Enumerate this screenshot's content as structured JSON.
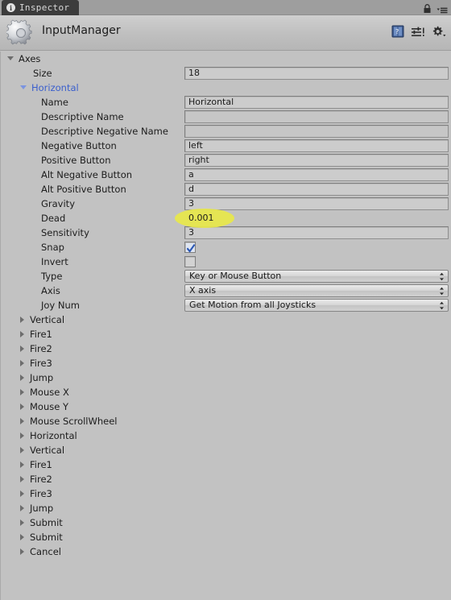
{
  "window": {
    "tab_label": "Inspector",
    "tab_icon": "info-circle-icon",
    "lock_icon": "lock-icon",
    "tab_menu_icon": "hamburger-menu-icon"
  },
  "header": {
    "icon": "gear-logo-icon",
    "title": "InputManager",
    "icons": [
      {
        "name": "help-book-icon"
      },
      {
        "name": "preset-sliders-icon"
      },
      {
        "name": "settings-gear-icon"
      }
    ]
  },
  "inspector": {
    "root": {
      "label": "Axes",
      "expanded": true
    },
    "size": {
      "label": "Size",
      "value": "18"
    },
    "expanded_axis": {
      "label": "Horizontal",
      "expanded": true,
      "properties": [
        {
          "label": "Name",
          "type": "text",
          "value": "Horizontal"
        },
        {
          "label": "Descriptive Name",
          "type": "text",
          "value": ""
        },
        {
          "label": "Descriptive Negative Name",
          "type": "text",
          "value": ""
        },
        {
          "label": "Negative Button",
          "type": "text",
          "value": "left"
        },
        {
          "label": "Positive Button",
          "type": "text",
          "value": "right"
        },
        {
          "label": "Alt Negative Button",
          "type": "text",
          "value": "a"
        },
        {
          "label": "Alt Positive Button",
          "type": "text",
          "value": "d"
        },
        {
          "label": "Gravity",
          "type": "text",
          "value": "3"
        },
        {
          "label": "Dead",
          "type": "text",
          "value": "0.001",
          "highlighted": true
        },
        {
          "label": "Sensitivity",
          "type": "text",
          "value": "3"
        },
        {
          "label": "Snap",
          "type": "checkbox",
          "value": true
        },
        {
          "label": "Invert",
          "type": "checkbox",
          "value": false
        },
        {
          "label": "Type",
          "type": "dropdown",
          "value": "Key or Mouse Button"
        },
        {
          "label": "Axis",
          "type": "dropdown",
          "value": "X axis"
        },
        {
          "label": "Joy Num",
          "type": "dropdown",
          "value": "Get Motion from all Joysticks"
        }
      ]
    },
    "collapsed_axes": [
      {
        "label": "Vertical"
      },
      {
        "label": "Fire1"
      },
      {
        "label": "Fire2"
      },
      {
        "label": "Fire3"
      },
      {
        "label": "Jump"
      },
      {
        "label": "Mouse X"
      },
      {
        "label": "Mouse Y"
      },
      {
        "label": "Mouse ScrollWheel"
      },
      {
        "label": "Horizontal"
      },
      {
        "label": "Vertical"
      },
      {
        "label": "Fire1"
      },
      {
        "label": "Fire2"
      },
      {
        "label": "Fire3"
      },
      {
        "label": "Jump"
      },
      {
        "label": "Submit"
      },
      {
        "label": "Submit"
      },
      {
        "label": "Cancel"
      }
    ]
  },
  "colors": {
    "panel_bg": "#c2c2c2",
    "tab_bg": "#3c3c3c",
    "tab_strip_bg": "#9e9e9e",
    "field_bg": "#cccccc",
    "link_blue": "#3a5fcd",
    "highlight_yellow": "#e8e84a",
    "checkbox_checked": "#3a6fd0"
  }
}
